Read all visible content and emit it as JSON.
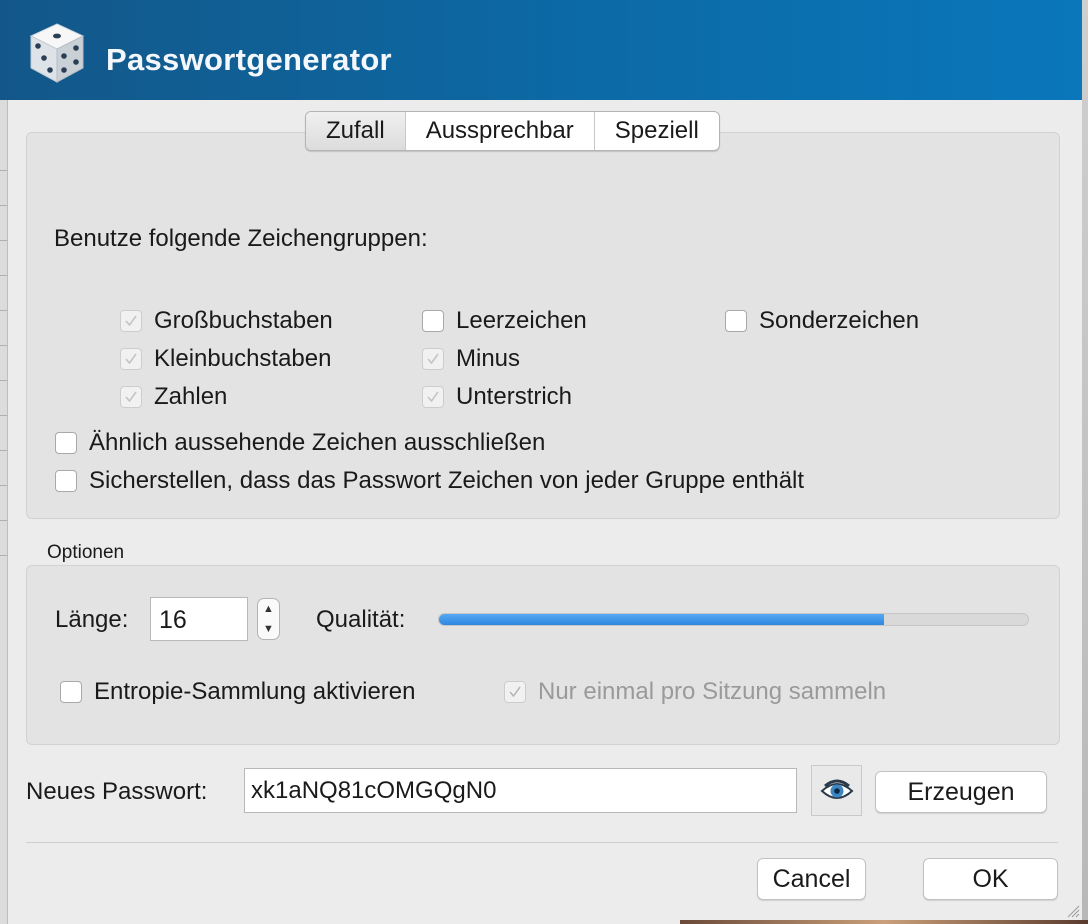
{
  "window": {
    "title": "Passwortgenerator",
    "icon": "dice-icon"
  },
  "tabs": [
    {
      "label": "Zufall",
      "selected": true
    },
    {
      "label": "Aussprechbar",
      "selected": false
    },
    {
      "label": "Speziell",
      "selected": false
    }
  ],
  "groups": {
    "heading": "Benutze folgende Zeichengruppen:",
    "uppercase": {
      "label": "Großbuchstaben",
      "checked": true,
      "enabled": false
    },
    "lowercase": {
      "label": "Kleinbuchstaben",
      "checked": true,
      "enabled": false
    },
    "digits": {
      "label": "Zahlen",
      "checked": true,
      "enabled": false
    },
    "space": {
      "label": "Leerzeichen",
      "checked": false,
      "enabled": true
    },
    "minus": {
      "label": "Minus",
      "checked": true,
      "enabled": false
    },
    "underscore": {
      "label": "Unterstrich",
      "checked": true,
      "enabled": false
    },
    "special": {
      "label": "Sonderzeichen",
      "checked": false,
      "enabled": true
    },
    "exclude_similar": {
      "label": "Ähnlich aussehende Zeichen ausschließen",
      "checked": false
    },
    "every_group": {
      "label": "Sicherstellen, dass das Passwort Zeichen von jeder Gruppe enthält",
      "checked": false
    }
  },
  "options": {
    "heading": "Optionen",
    "length_label": "Länge:",
    "length_value": "16",
    "quality_label": "Qualität:",
    "quality_fraction": 0.755,
    "entropy": {
      "label": "Entropie-Sammlung aktivieren",
      "checked": false
    },
    "once_per_session": {
      "label": "Nur einmal pro Sitzung sammeln",
      "checked": true,
      "enabled": false
    }
  },
  "password": {
    "label": "Neues Passwort:",
    "value": "xk1aNQ81cOMGQgN0",
    "toggle_icon": "eye-icon",
    "generate_label": "Erzeugen"
  },
  "buttons": {
    "cancel": "Cancel",
    "ok": "OK"
  },
  "colors": {
    "titlebar_start": "#135789",
    "titlebar_end": "#0a77bb",
    "quality_fill": "#3a8ee6"
  }
}
